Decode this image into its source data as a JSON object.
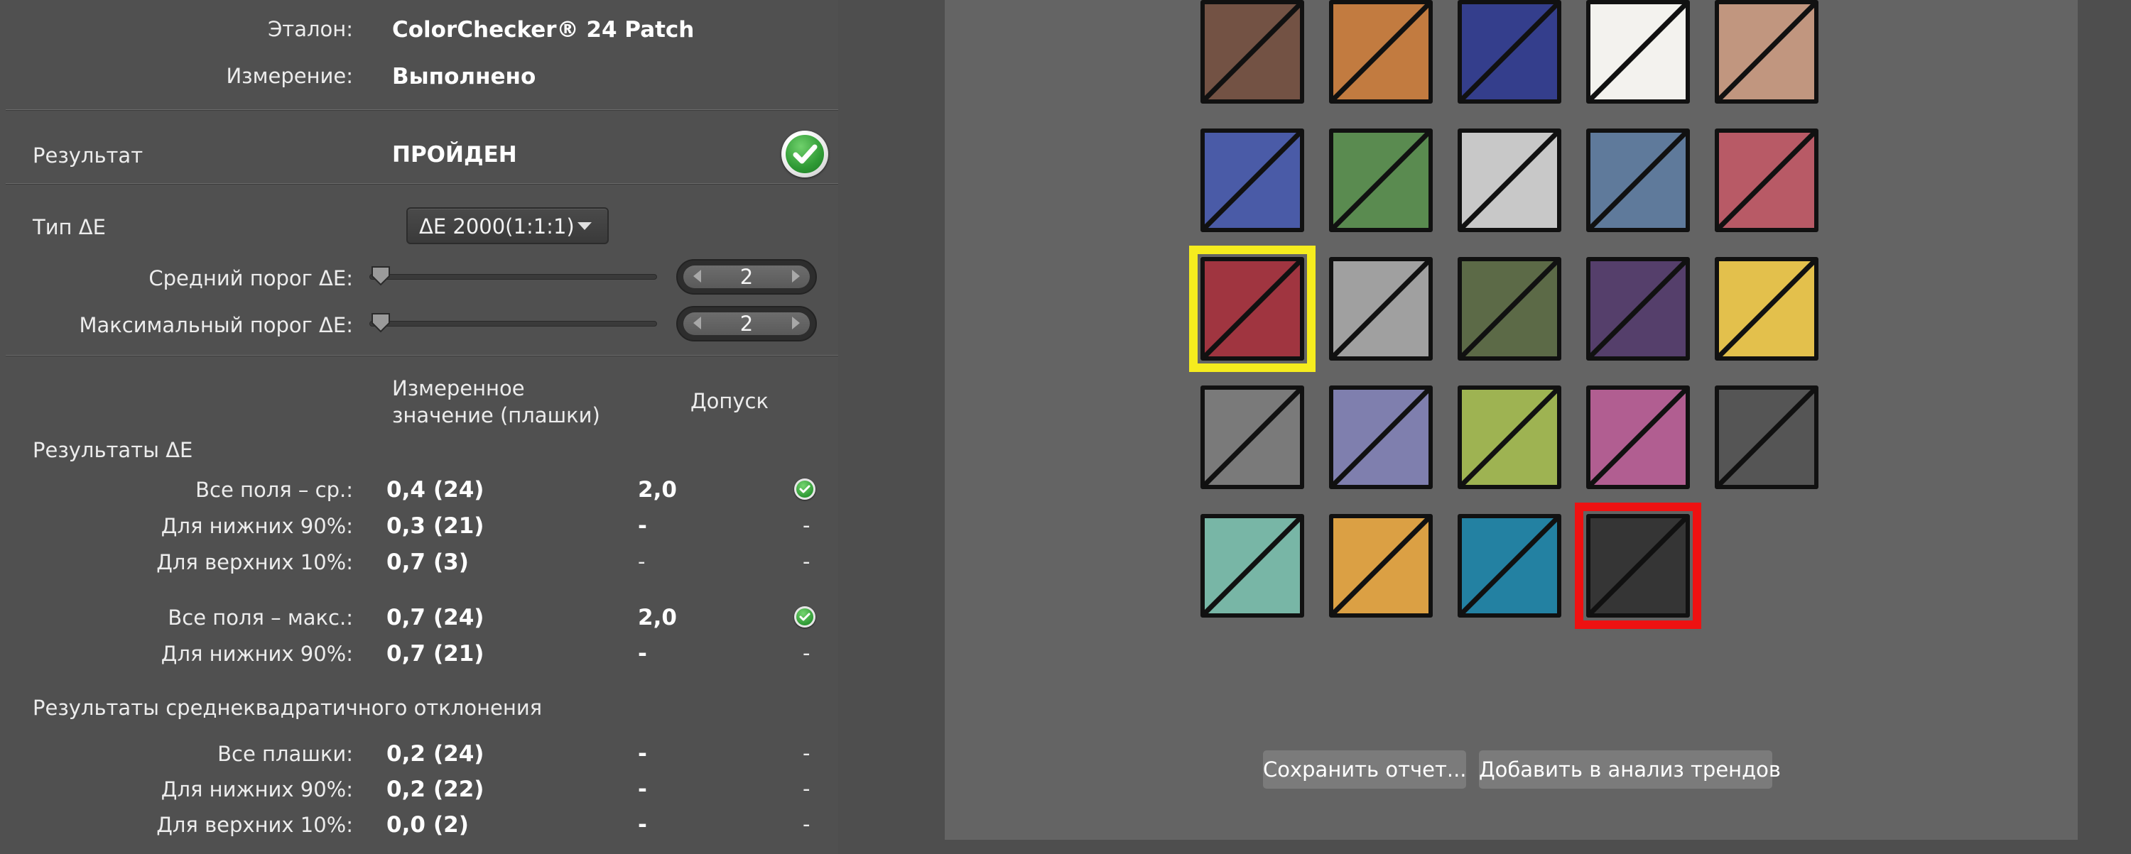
{
  "header": {
    "reference_label": "Эталон:",
    "reference_value": "ColorChecker® 24 Patch",
    "measurement_label": "Измерение:",
    "measurement_value": "Выполнено"
  },
  "result": {
    "label": "Результат",
    "value": "ПРОЙДЕН",
    "icon": "check-icon",
    "color": "#2f9a35"
  },
  "delta_type": {
    "label": "Тип ΔE",
    "selected": "ΔE 2000(1:1:1)"
  },
  "avg_threshold": {
    "label": "Средний порог ΔE:",
    "value": "2",
    "slider_fraction": 0.04
  },
  "max_threshold": {
    "label": "Максимальный порог ΔE:",
    "value": "2",
    "slider_fraction": 0.04
  },
  "columns": {
    "measured": "Измеренное значение (плашки)",
    "tolerance": "Допуск"
  },
  "de_results": {
    "title": "Результаты ΔE",
    "rows": [
      {
        "label": "Все поля – ср.:",
        "value": "0,4",
        "count": "(24)",
        "tolerance": "2,0",
        "status": "pass"
      },
      {
        "label": "Для нижних 90%:",
        "value": "0,3",
        "count": "(21)",
        "tolerance": "-",
        "status": "-"
      },
      {
        "label": "Для верхних 10%:",
        "value": "0,7",
        "count": "(3)",
        "tolerance": "-",
        "status": "-"
      },
      {
        "label": "Все поля – макс.:",
        "value": "0,7",
        "count": "(24)",
        "tolerance": "2,0",
        "status": "pass"
      },
      {
        "label": "Для нижних 90%:",
        "value": "0,7",
        "count": "(21)",
        "tolerance": "-",
        "status": "-"
      }
    ]
  },
  "rms_results": {
    "title": "Результаты среднеквадратичного отклонения",
    "rows": [
      {
        "label": "Все плашки:",
        "value": "0,2",
        "count": "(24)",
        "tolerance": "-",
        "status": "-"
      },
      {
        "label": "Для нижних 90%:",
        "value": "0,2",
        "count": "(22)",
        "tolerance": "-",
        "status": "-"
      },
      {
        "label": "Для верхних 10%:",
        "value": "0,0",
        "count": "(2)",
        "tolerance": "-",
        "status": "-"
      }
    ]
  },
  "patches": [
    {
      "color": "#735244"
    },
    {
      "color": "#c27b40"
    },
    {
      "color": "#343e8c"
    },
    {
      "color": "#f3f2ee"
    },
    {
      "color": "#c1967f"
    },
    {
      "color": "#4a5ba7"
    },
    {
      "color": "#5a8b50"
    },
    {
      "color": "#c8c8c8"
    },
    {
      "color": "#5f7a9b"
    },
    {
      "color": "#b85a66"
    },
    {
      "color": "#a03540"
    },
    {
      "color": "#a0a0a0"
    },
    {
      "color": "#5c6a47"
    },
    {
      "color": "#553f6b"
    },
    {
      "color": "#e3c04c"
    },
    {
      "color": "#7a7a7a"
    },
    {
      "color": "#7f7fae"
    },
    {
      "color": "#9eb352"
    },
    {
      "color": "#b15e91"
    },
    {
      "color": "#555555"
    },
    {
      "color": "#78b6a6"
    },
    {
      "color": "#dba044"
    },
    {
      "color": "#2381a2"
    },
    {
      "color": "#353535"
    }
  ],
  "highlights": {
    "yellow_index": 10,
    "red_index": 23,
    "yellow_color": "#f5ec1e",
    "red_color": "#ee1111"
  },
  "buttons": {
    "save_report": "Сохранить отчет...",
    "add_trend": "Добавить в анализ трендов"
  }
}
